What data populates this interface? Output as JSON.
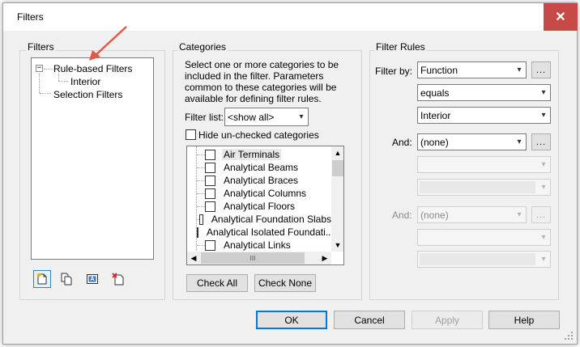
{
  "window": {
    "title": "Filters",
    "close_glyph": "✕"
  },
  "filters_panel": {
    "label": "Filters",
    "tree": {
      "root": "Rule-based Filters",
      "child": "Interior",
      "sibling": "Selection Filters",
      "expander": "−"
    },
    "toolbar": [
      "new-filter-icon",
      "duplicate-icon",
      "rename-icon",
      "delete-icon"
    ]
  },
  "categories_panel": {
    "label": "Categories",
    "description": [
      "Select one or more categories to be",
      "included in the filter.  Parameters",
      "common to these categories will be",
      "available for defining filter rules."
    ],
    "filter_list_label": "Filter list:",
    "filter_list_value": "<show all>",
    "hide_unchecked_label": "Hide un-checked categories",
    "items": [
      "Air Terminals",
      "Analytical Beams",
      "Analytical Braces",
      "Analytical Columns",
      "Analytical Floors",
      "Analytical Foundation Slabs",
      "Analytical Isolated Foundati...",
      "Analytical Links"
    ],
    "check_all": "Check All",
    "check_none": "Check None",
    "hscroll_thumb": "III"
  },
  "rules_panel": {
    "label": "Filter Rules",
    "filter_by_label": "Filter by:",
    "filter_by_value": "Function",
    "operator_value": "equals",
    "value_value": "Interior",
    "and1_label": "And:",
    "and1_value": "(none)",
    "and2_label": "And:",
    "and2_value": "(none)",
    "ellipsis": "..."
  },
  "footer": {
    "ok": "OK",
    "cancel": "Cancel",
    "apply": "Apply",
    "help": "Help"
  },
  "colors": {
    "close_bg": "#c74a47",
    "arrow": "#e05a4a",
    "focus": "#0078d7"
  }
}
